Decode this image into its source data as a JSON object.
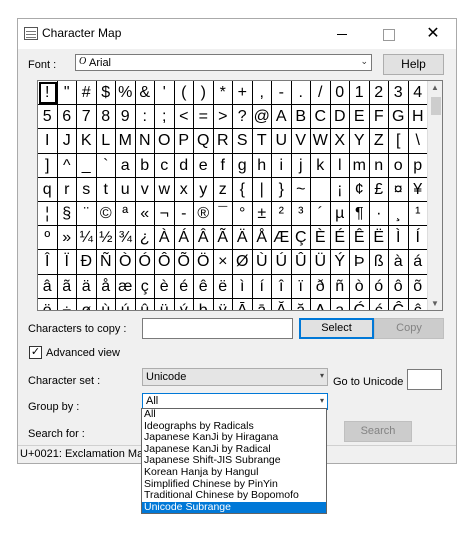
{
  "window": {
    "title": "Character Map",
    "icon": "charmap-app-icon"
  },
  "titlebar": {
    "minimize_icon": "minimize-icon",
    "maximize_icon": "maximize-icon",
    "close_glyph": "✕"
  },
  "font": {
    "label": "Font :",
    "icon_glyph": "O",
    "value": "Arial",
    "arrow": "⌄"
  },
  "help": {
    "label": "Help"
  },
  "grid": {
    "selected_index": 0,
    "characters": [
      "!",
      "\"",
      "#",
      "$",
      "%",
      "&",
      "'",
      "(",
      ")",
      "*",
      "+",
      ",",
      "-",
      ".",
      "/",
      "0",
      "1",
      "2",
      "3",
      "4",
      "5",
      "6",
      "7",
      "8",
      "9",
      ":",
      ";",
      "<",
      "=",
      ">",
      "?",
      "@",
      "A",
      "B",
      "C",
      "D",
      "E",
      "F",
      "G",
      "H",
      "I",
      "J",
      "K",
      "L",
      "M",
      "N",
      "O",
      "P",
      "Q",
      "R",
      "S",
      "T",
      "U",
      "V",
      "W",
      "X",
      "Y",
      "Z",
      "[",
      "\\",
      "]",
      "^",
      "_",
      "`",
      "a",
      "b",
      "c",
      "d",
      "e",
      "f",
      "g",
      "h",
      "i",
      "j",
      "k",
      "l",
      "m",
      "n",
      "o",
      "p",
      "q",
      "r",
      "s",
      "t",
      "u",
      "v",
      "w",
      "x",
      "y",
      "z",
      "{",
      "|",
      "}",
      "~",
      " ",
      "¡",
      "¢",
      "£",
      "¤",
      "¥",
      "¦",
      "§",
      "¨",
      "©",
      "ª",
      "«",
      "¬",
      "-",
      "®",
      "¯",
      "°",
      "±",
      "²",
      "³",
      "´",
      "µ",
      "¶",
      "·",
      "¸",
      "¹",
      "º",
      "»",
      "¼",
      "½",
      "¾",
      "¿",
      "À",
      "Á",
      "Â",
      "Ã",
      "Ä",
      "Å",
      "Æ",
      "Ç",
      "È",
      "É",
      "Ê",
      "Ë",
      "Ì",
      "Í",
      "Î",
      "Ï",
      "Ð",
      "Ñ",
      "Ò",
      "Ó",
      "Ô",
      "Õ",
      "Ö",
      "×",
      "Ø",
      "Ù",
      "Ú",
      "Û",
      "Ü",
      "Ý",
      "Þ",
      "ß",
      "à",
      "á",
      "â",
      "ã",
      "ä",
      "å",
      "æ",
      "ç",
      "è",
      "é",
      "ê",
      "ë",
      "ì",
      "í",
      "î",
      "ï",
      "ð",
      "ñ",
      "ò",
      "ó",
      "ô",
      "õ",
      "ö",
      "÷",
      "ø",
      "ù",
      "ú",
      "û",
      "ü",
      "ý",
      "þ",
      "ÿ",
      "Ā",
      "ā",
      "Ă",
      "ă",
      "Ą",
      "ą",
      "Ć",
      "ć",
      "Ĉ",
      "ĉ"
    ]
  },
  "scrollbar": {
    "up": "▲",
    "down": "▼"
  },
  "copy": {
    "label": "Characters to copy :",
    "value": "",
    "select_label": "Select",
    "copy_label": "Copy"
  },
  "advanced": {
    "label": "Advanced view",
    "checked": true,
    "check_glyph": "✓"
  },
  "charset": {
    "label": "Character set :",
    "value": "Unicode",
    "arrow": "▾"
  },
  "goto": {
    "label": "Go to Unicode :",
    "value": ""
  },
  "group": {
    "label": "Group by :",
    "value": "All",
    "arrow": "▾"
  },
  "search": {
    "label": "Search for :",
    "button_label": "Search"
  },
  "status": {
    "text": "U+0021: Exclamation Ma"
  },
  "dropdown": {
    "active_index": 8,
    "options": [
      "All",
      "Ideographs by Radicals",
      "Japanese KanJi by Hiragana",
      "Japanese KanJi by Radical",
      "Japanese Shift-JIS Subrange",
      "Korean Hanja by Hangul",
      "Simplified Chinese by PinYin",
      "Traditional Chinese by Bopomofo",
      "Unicode Subrange"
    ]
  },
  "colors": {
    "accent": "#0078d7",
    "window_bg": "#f0f0f0",
    "disabled_text": "#838383"
  }
}
